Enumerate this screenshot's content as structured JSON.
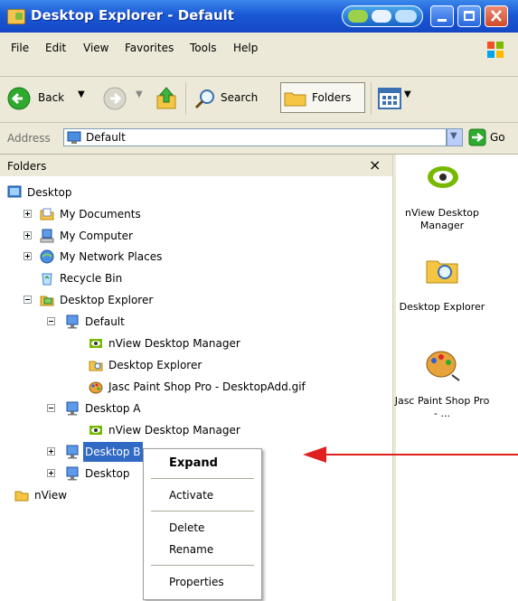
{
  "window": {
    "title": "Desktop Explorer - Default",
    "colors": {
      "titlebar": "#1a59d6",
      "chrome": "#ece9d8",
      "selection": "#316ac5",
      "arrow": "#e02020"
    }
  },
  "menu": [
    "File",
    "Edit",
    "View",
    "Favorites",
    "Tools",
    "Help"
  ],
  "toolbar": {
    "back_label": "Back",
    "search_label": "Search",
    "folders_label": "Folders"
  },
  "address": {
    "label": "Address",
    "value": "Default",
    "go_label": "Go"
  },
  "folders_pane": {
    "title": "Folders",
    "close_glyph": "×",
    "tree": {
      "desktop": "Desktop",
      "my_documents": "My Documents",
      "my_computer": "My Computer",
      "my_network_places": "My Network Places",
      "recycle_bin": "Recycle Bin",
      "desktop_explorer": "Desktop Explorer",
      "default": "Default",
      "nview_desktop_manager_1": "nView Desktop Manager",
      "desktop_explorer_child": "Desktop Explorer",
      "jasc": "Jasc Paint Shop Pro - DesktopAdd.gif",
      "desktop_a": "Desktop A",
      "nview_desktop_manager_2": "nView Desktop Manager",
      "desktop_b": "Desktop B",
      "desktop_c": "Desktop",
      "nview": "nView"
    }
  },
  "right_pane": {
    "items": [
      {
        "label": "nView Desktop Manager",
        "icon": "nvidia-eye-icon"
      },
      {
        "label": "Desktop Explorer",
        "icon": "folder-search-icon"
      },
      {
        "label": "Jasc Paint Shop Pro - ...",
        "icon": "palette-icon"
      }
    ]
  },
  "context_menu": {
    "expand": "Expand",
    "activate": "Activate",
    "delete": "Delete",
    "rename": "Rename",
    "properties": "Properties"
  }
}
